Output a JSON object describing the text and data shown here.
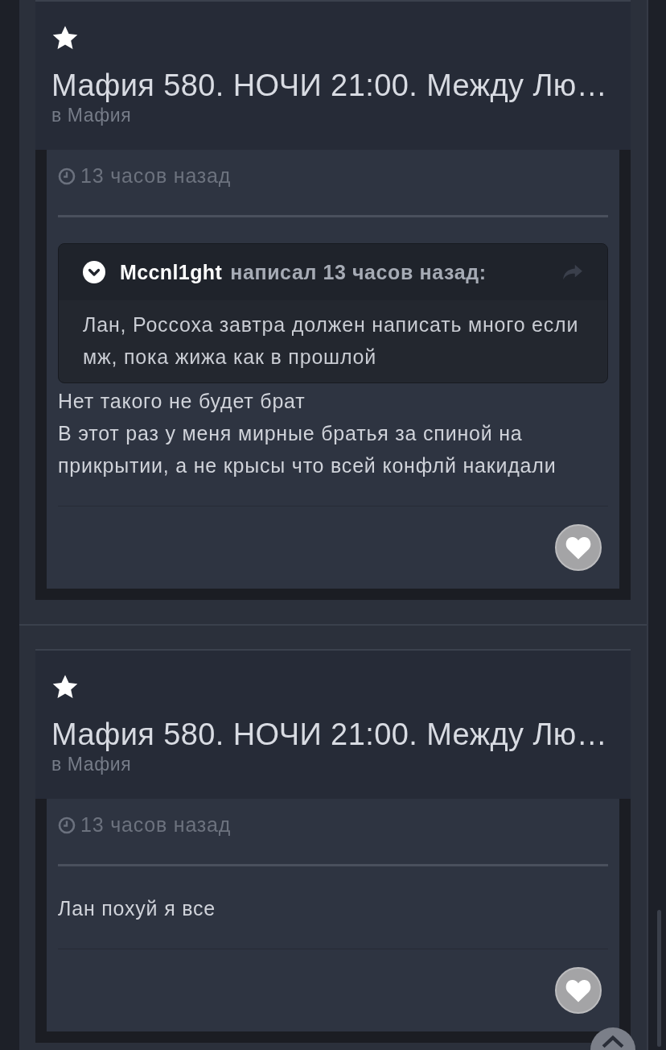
{
  "posts": [
    {
      "title": "Мафия 580. НОЧИ 21:00. Между Лю…",
      "forum": "в Мафия",
      "time": "13 часов назад",
      "quote": {
        "author": "Mccnl1ght",
        "wrote": "написал 13 часов назад:",
        "text": "Лан, Россоха завтра должен написать много если мж, пока жижа как в прошлой"
      },
      "paragraphs": [
        "Нет такого не будет брат",
        "В этот раз у меня мирные братья за спиной на прикрытии, а не крысы что всей конфлй накидали"
      ]
    },
    {
      "title": "Мафия 580. НОЧИ 21:00. Между Лю…",
      "forum": "в Мафия",
      "time": "13 часов назад",
      "paragraphs": [
        "Лан похуй я все"
      ]
    }
  ]
}
